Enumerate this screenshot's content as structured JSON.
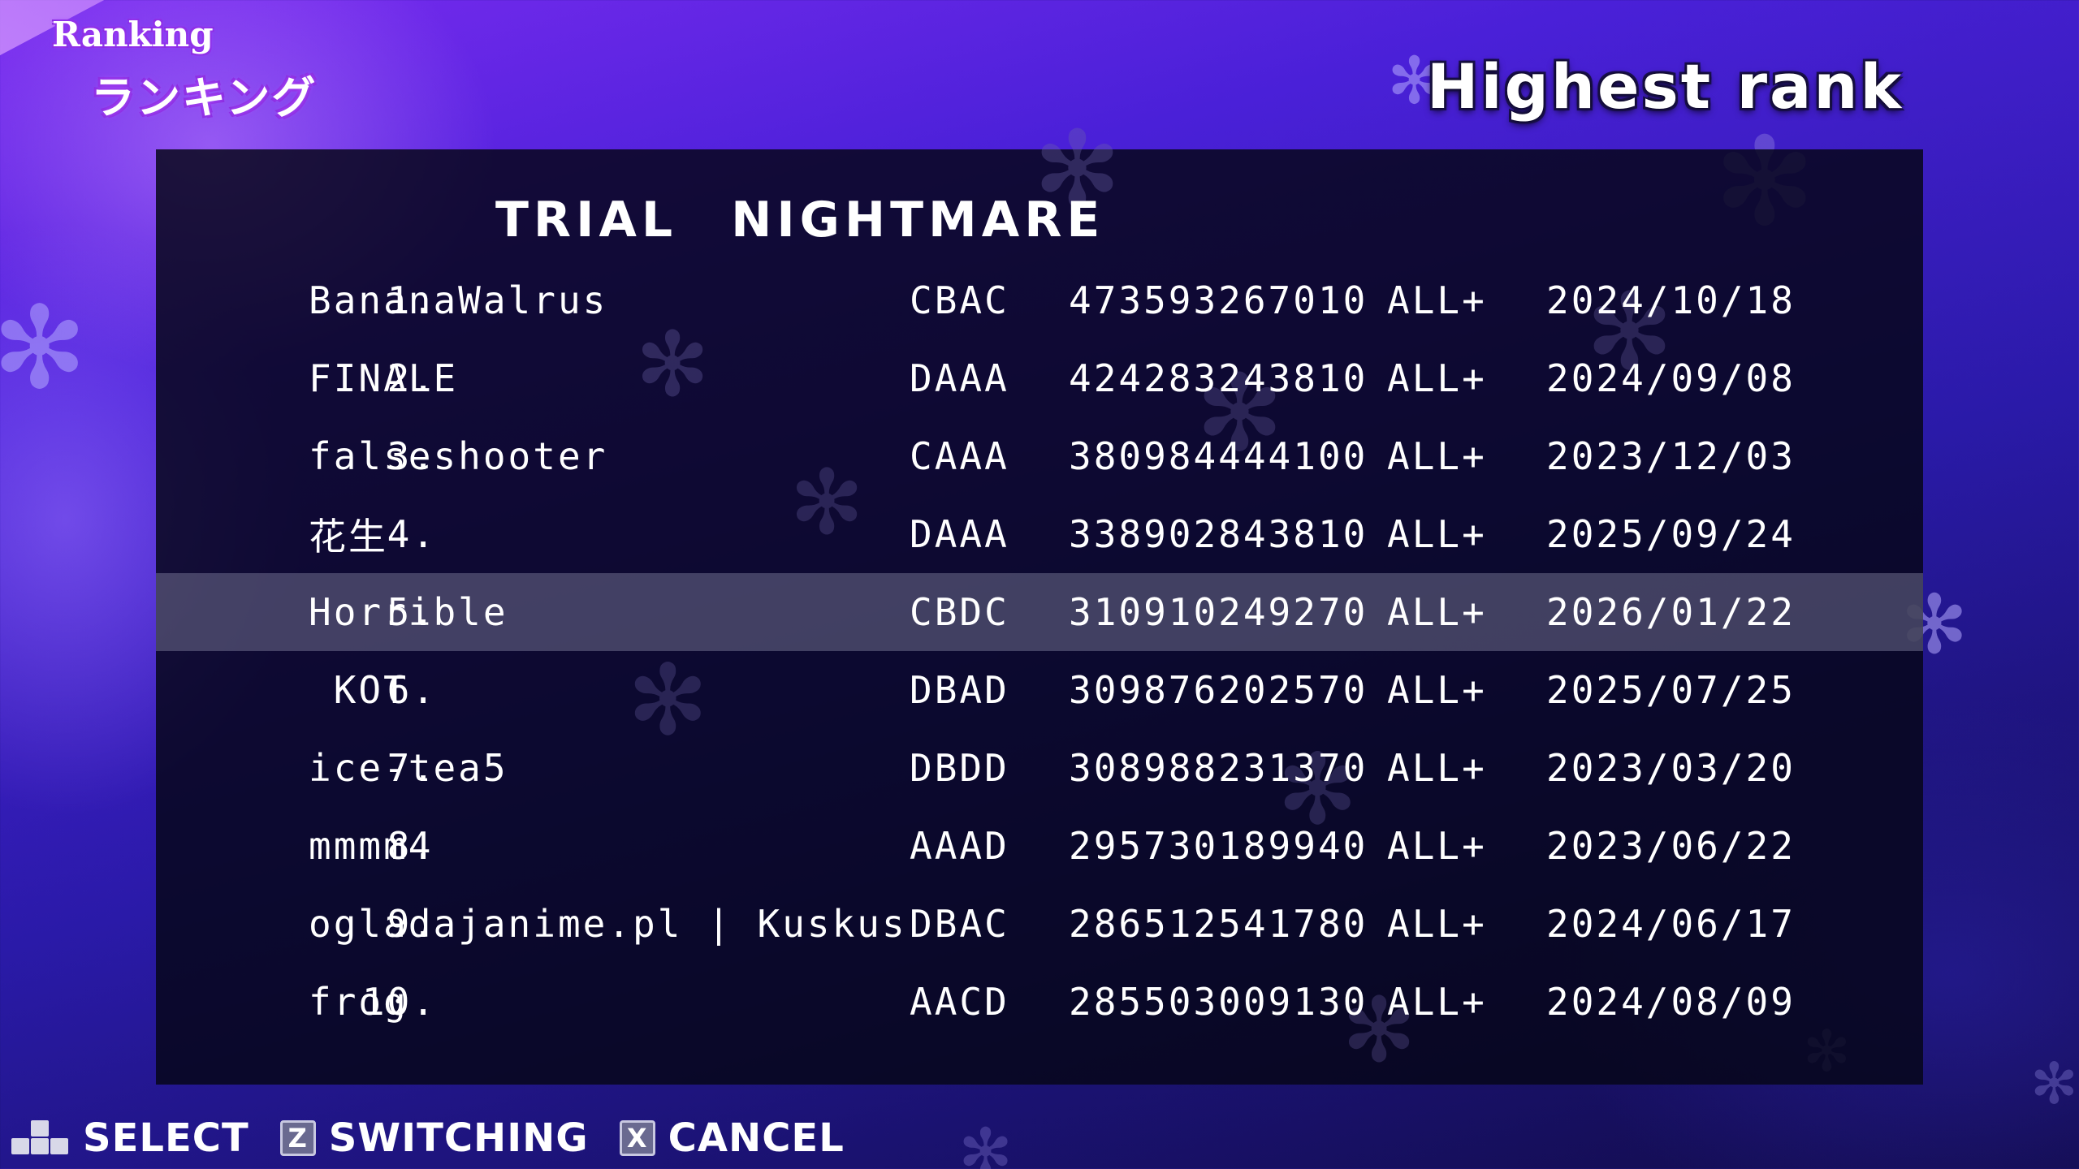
{
  "header": {
    "title_en": "Ranking",
    "title_jp": "ランキング",
    "mode": "Highest rank"
  },
  "panel": {
    "heading": "TRIAL　NIGHTMARE"
  },
  "rankings": [
    {
      "rank": "1.",
      "name": "BananaWalrus",
      "judge": "CBAC",
      "score": "473593267010",
      "clear": "ALL+",
      "date": "2024/10/18"
    },
    {
      "rank": "2.",
      "name": "FINALE",
      "judge": "DAAA",
      "score": "424283243810",
      "clear": "ALL+",
      "date": "2024/09/08"
    },
    {
      "rank": "3.",
      "name": "falseshooter",
      "judge": "CAAA",
      "score": "380984444100",
      "clear": "ALL+",
      "date": "2023/12/03"
    },
    {
      "rank": "4.",
      "name": "花生",
      "judge": "DAAA",
      "score": "338902843810",
      "clear": "ALL+",
      "date": "2025/09/24"
    },
    {
      "rank": "5.",
      "name": "Horrible",
      "judge": "CBDC",
      "score": "310910249270",
      "clear": "ALL+",
      "date": "2026/01/22"
    },
    {
      "rank": "6.",
      "name": " KOT",
      "judge": "DBAD",
      "score": "309876202570",
      "clear": "ALL+",
      "date": "2025/07/25"
    },
    {
      "rank": "7.",
      "name": "ice-tea5",
      "judge": "DBDD",
      "score": "308988231370",
      "clear": "ALL+",
      "date": "2023/03/20"
    },
    {
      "rank": "8.",
      "name": "mmmm4",
      "judge": "AAAD",
      "score": "295730189940",
      "clear": "ALL+",
      "date": "2023/06/22"
    },
    {
      "rank": "9.",
      "name": "ogladajanime.pl | Kuskus",
      "judge": "DBAC",
      "score": "286512541780",
      "clear": "ALL+",
      "date": "2024/06/17"
    },
    {
      "rank": "10.",
      "name": "frog",
      "judge": "AACD",
      "score": "285503009130",
      "clear": "ALL+",
      "date": "2024/08/09"
    }
  ],
  "selected_index": 4,
  "footer": {
    "select_label": "SELECT",
    "switch_key": "Z",
    "switch_label": "SWITCHING",
    "cancel_key": "X",
    "cancel_label": "CANCEL"
  },
  "icons": {
    "select": "dpad-icon",
    "switch": "z-key-icon",
    "cancel": "x-key-icon"
  },
  "colors": {
    "accent": "#8a2ce0",
    "highlight_row": "#5a5a78",
    "background_top": "#7a2cf0",
    "background_bottom": "#120c4a"
  }
}
